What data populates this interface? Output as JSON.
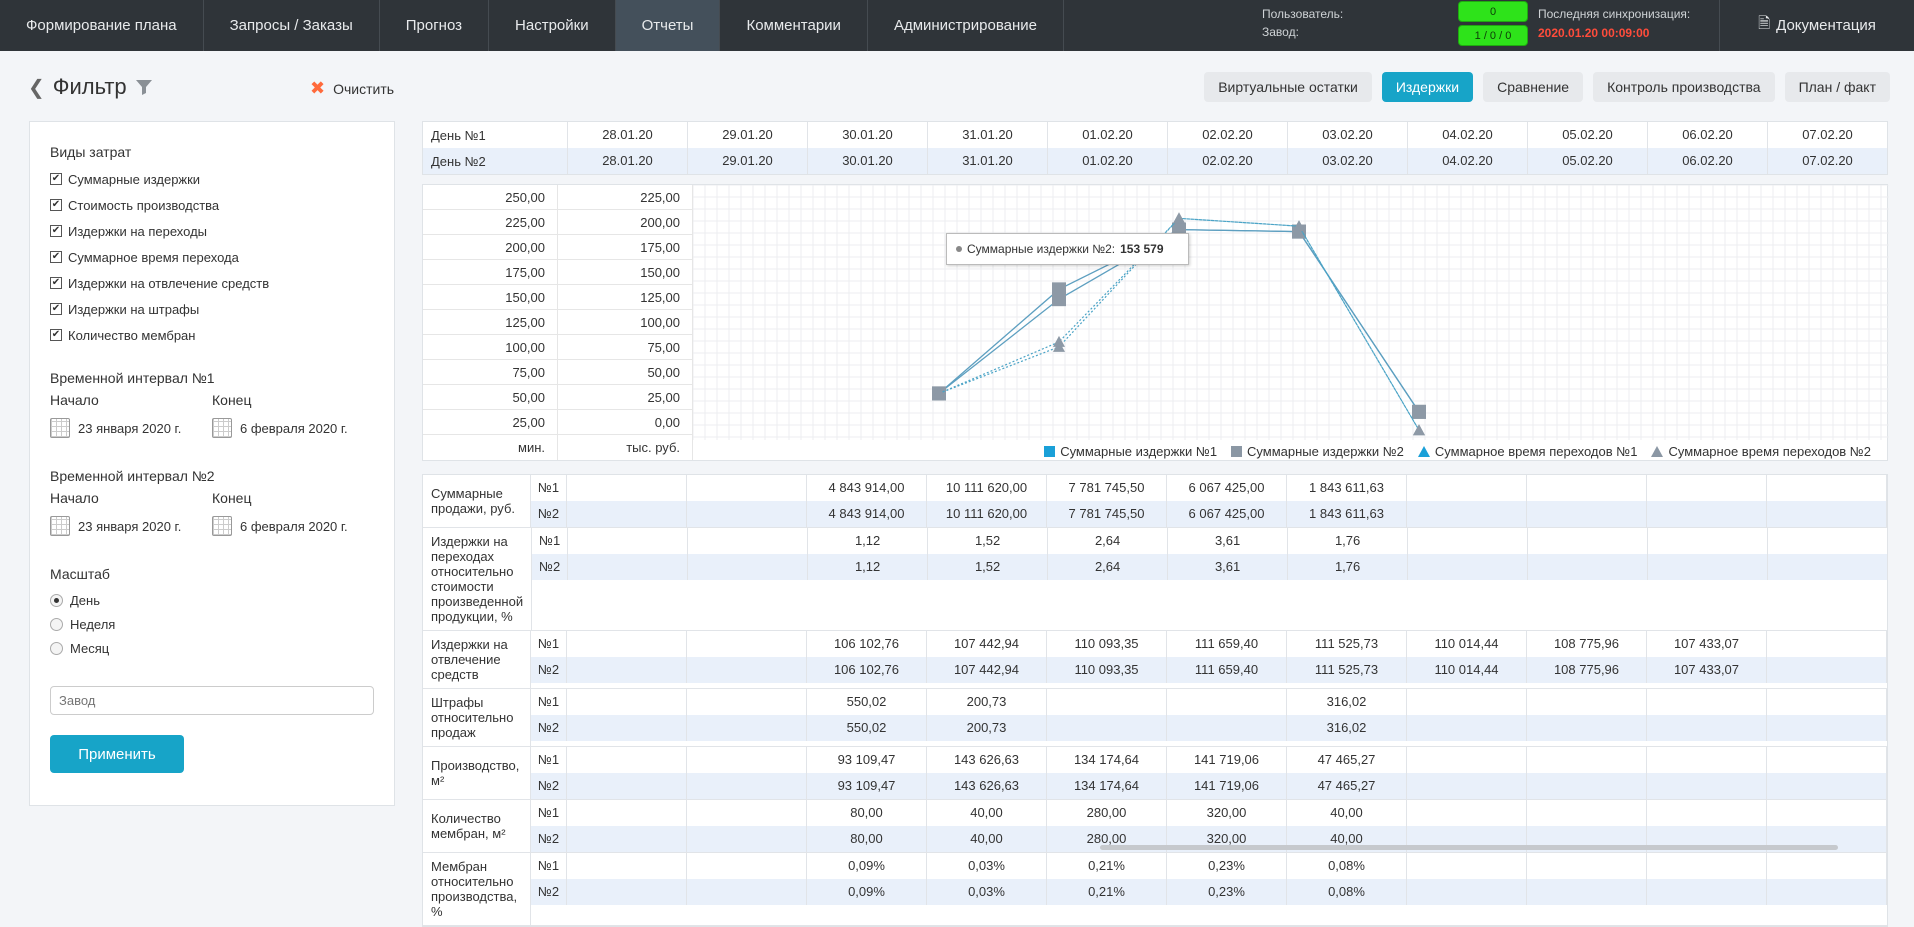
{
  "nav": {
    "items": [
      "Формирование плана",
      "Запросы / Заказы",
      "Прогноз",
      "Настройки",
      "Отчеты",
      "Комментарии",
      "Администрирование"
    ],
    "active": "Отчеты",
    "user_label": "Пользователь:",
    "plant_label": "Завод:",
    "badge1": "0",
    "badge2": "1 / 0 / 0",
    "sync_label": "Последняя синхронизация:",
    "sync_value": "2020.01.20 00:09:00",
    "docs": "Документация"
  },
  "filter": {
    "title": "Фильтр",
    "clear": "Очистить",
    "cost_types_title": "Виды затрат",
    "cost_types": [
      "Суммарные издержки",
      "Стоимость производства",
      "Издержки на переходы",
      "Суммарное время перехода",
      "Издержки на отвлечение средств",
      "Издержки на штрафы",
      "Количество мембран"
    ],
    "interval1": {
      "title": "Временной интервал №1",
      "start_label": "Начало",
      "end_label": "Конец",
      "start": "23 января 2020 г.",
      "end": "6 февраля 2020 г."
    },
    "interval2": {
      "title": "Временной интервал №2",
      "start_label": "Начало",
      "end_label": "Конец",
      "start": "23 января 2020 г.",
      "end": "6 февраля 2020 г."
    },
    "scale_title": "Масштаб",
    "scale_options": [
      "День",
      "Неделя",
      "Месяц"
    ],
    "scale_selected": "День",
    "plant_placeholder": "Завод",
    "apply": "Применить"
  },
  "tabs": [
    "Виртуальные остатки",
    "Издержки",
    "Сравнение",
    "Контроль производства",
    "План / факт"
  ],
  "active_tab": "Издержки",
  "days": {
    "row1_label": "День №1",
    "row2_label": "День №2",
    "dates": [
      "28.01.20",
      "29.01.20",
      "30.01.20",
      "31.01.20",
      "01.02.20",
      "02.02.20",
      "03.02.20",
      "04.02.20",
      "05.02.20",
      "06.02.20",
      "07.02.20"
    ]
  },
  "chart_data": {
    "type": "line",
    "left_axis_ticks": [
      "250,00",
      "225,00",
      "200,00",
      "175,00",
      "150,00",
      "125,00",
      "100,00",
      "75,00",
      "50,00",
      "25,00"
    ],
    "right_axis_ticks": [
      "225,00",
      "200,00",
      "175,00",
      "150,00",
      "125,00",
      "100,00",
      "75,00",
      "50,00",
      "25,00",
      "0,00"
    ],
    "left_unit": "мин.",
    "right_unit": "тыс. руб.",
    "x": [
      "30.01.20",
      "31.01.20",
      "01.02.20",
      "02.02.20",
      "03.02.20"
    ],
    "series": [
      {
        "name": "Суммарные издержки №1",
        "color": "#1aa0d8",
        "values": [
          47.5,
          143.6,
          214.5,
          212.5,
          28.7
        ]
      },
      {
        "name": "Суммарные издержки №2",
        "color": "#8b97a4",
        "values": [
          47.5,
          153.6,
          214.5,
          212.5,
          28.7
        ]
      },
      {
        "name": "Суммарное время переходов №1",
        "color": "#1aa0d8",
        "values": [
          47.5,
          95,
          226,
          218,
          10
        ]
      },
      {
        "name": "Суммарное время переходов №2",
        "color": "#8b97a4",
        "values": [
          47.5,
          100,
          226,
          218,
          10
        ]
      }
    ],
    "tooltip": {
      "label": "Суммарные издержки №2:",
      "value": "153 579"
    }
  },
  "metrics": [
    {
      "label": "Суммарные продажи, руб.",
      "r1": [
        "",
        "",
        "4 843 914,00",
        "10 111 620,00",
        "7 781 745,50",
        "6 067 425,00",
        "1 843 611,63",
        "",
        "",
        "",
        ""
      ],
      "r2": [
        "",
        "",
        "4 843 914,00",
        "10 111 620,00",
        "7 781 745,50",
        "6 067 425,00",
        "1 843 611,63",
        "",
        "",
        "",
        ""
      ]
    },
    {
      "label": "Издержки на переходах относительно стоимости произведенной продукции, %",
      "r1": [
        "",
        "",
        "1,12",
        "1,52",
        "2,64",
        "3,61",
        "1,76",
        "",
        "",
        "",
        ""
      ],
      "r2": [
        "",
        "",
        "1,12",
        "1,52",
        "2,64",
        "3,61",
        "1,76",
        "",
        "",
        "",
        ""
      ]
    },
    {
      "label": "Издержки на отвлечение средств",
      "r1": [
        "",
        "",
        "106 102,76",
        "107 442,94",
        "110 093,35",
        "111 659,40",
        "111 525,73",
        "110 014,44",
        "108 775,96",
        "107 433,07",
        ""
      ],
      "r2": [
        "",
        "",
        "106 102,76",
        "107 442,94",
        "110 093,35",
        "111 659,40",
        "111 525,73",
        "110 014,44",
        "108 775,96",
        "107 433,07",
        ""
      ]
    },
    {
      "label": "Штрафы относительно продаж",
      "r1": [
        "",
        "",
        "550,02",
        "200,73",
        "",
        "",
        "316,02",
        "",
        "",
        "",
        ""
      ],
      "r2": [
        "",
        "",
        "550,02",
        "200,73",
        "",
        "",
        "316,02",
        "",
        "",
        "",
        ""
      ]
    },
    {
      "label": "Производство, м²",
      "r1": [
        "",
        "",
        "93 109,47",
        "143 626,63",
        "134 174,64",
        "141 719,06",
        "47 465,27",
        "",
        "",
        "",
        ""
      ],
      "r2": [
        "",
        "",
        "93 109,47",
        "143 626,63",
        "134 174,64",
        "141 719,06",
        "47 465,27",
        "",
        "",
        "",
        ""
      ]
    },
    {
      "label": "Количество мембран, м²",
      "r1": [
        "",
        "",
        "80,00",
        "40,00",
        "280,00",
        "320,00",
        "40,00",
        "",
        "",
        "",
        ""
      ],
      "r2": [
        "",
        "",
        "80,00",
        "40,00",
        "280,00",
        "320,00",
        "40,00",
        "",
        "",
        "",
        ""
      ]
    },
    {
      "label": "Мембран относительно производства, %",
      "r1": [
        "",
        "",
        "0,09%",
        "0,03%",
        "0,21%",
        "0,23%",
        "0,08%",
        "",
        "",
        "",
        ""
      ],
      "r2": [
        "",
        "",
        "0,09%",
        "0,03%",
        "0,21%",
        "0,23%",
        "0,08%",
        "",
        "",
        "",
        ""
      ]
    }
  ],
  "metric_nums": [
    "№1",
    "№2"
  ]
}
